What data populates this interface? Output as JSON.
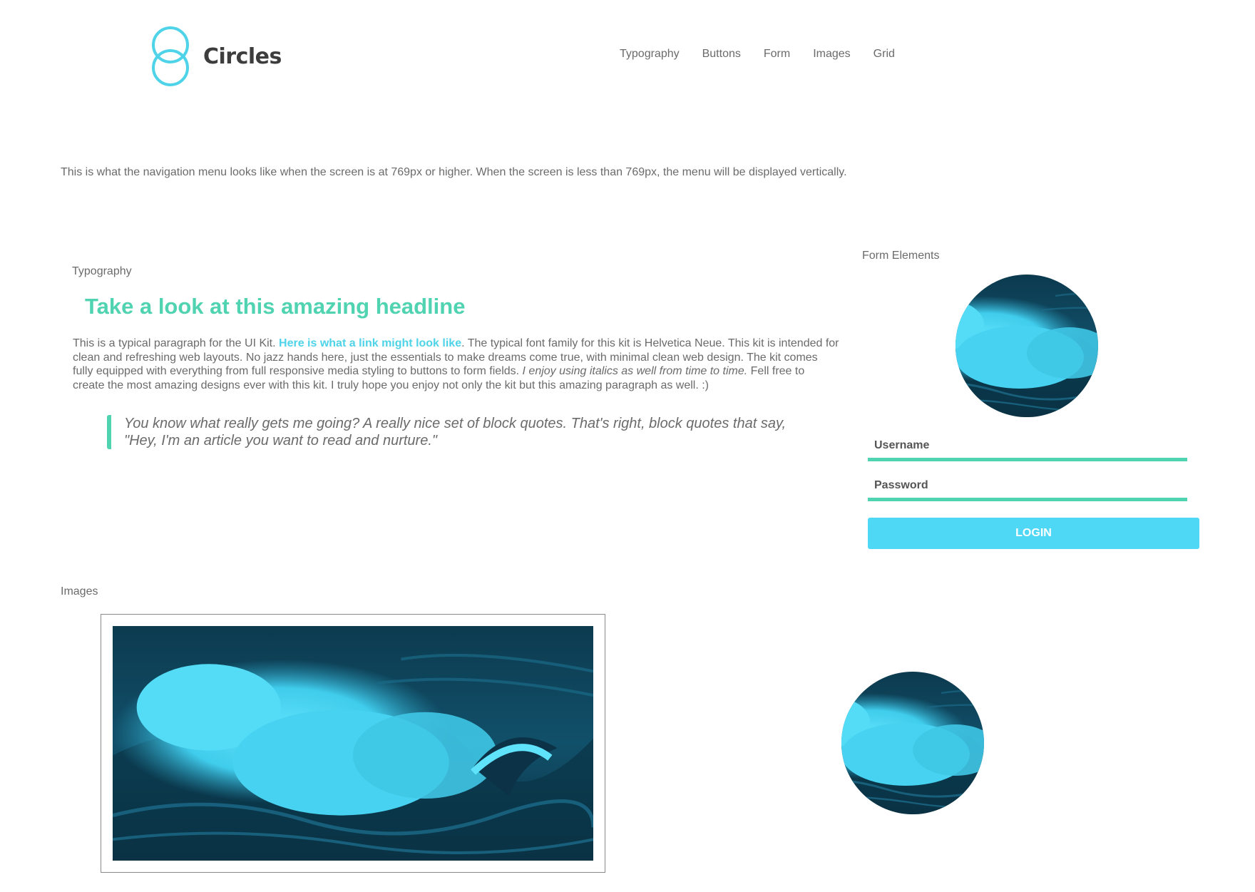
{
  "brand": {
    "name": "Circles",
    "accent": "#4fd3b0",
    "link_color": "#4fd3e8",
    "button_color": "#4fd8f5",
    "logo_icon": "circles-logo-icon"
  },
  "nav": {
    "items": [
      {
        "label": "Typography"
      },
      {
        "label": "Buttons"
      },
      {
        "label": "Form"
      },
      {
        "label": "Images"
      },
      {
        "label": "Grid"
      }
    ]
  },
  "intro_text": "This is what the navigation menu looks like when the screen is at 769px or higher. When the screen is less than 769px, the menu will be displayed vertically.",
  "typography": {
    "label": "Typography",
    "headline": "Take a look at this amazing headline",
    "paragraph": {
      "lead": "This is a typical paragraph for the UI Kit. ",
      "link": "Here is what a link might look like",
      "after_link": ". The typical font family for this kit is Helvetica Neue. This kit is intended for clean and refreshing web layouts. No jazz hands here, just the essentials to make dreams come true, with minimal clean web design. The kit comes fully equipped with everything from full responsive media styling to buttons to form fields. ",
      "italic": "I enjoy using italics as well from time to time.",
      "tail": " Fell free to create the most amazing designs ever with this kit. I truly hope you enjoy not only the kit but this amazing paragraph as well. :)"
    },
    "blockquote": "You know what really gets me going? A really nice set of block quotes. That's right, block quotes that say, \"Hey, I'm an article you want to read and nurture.\""
  },
  "form": {
    "label": "Form Elements",
    "username_placeholder": "Username",
    "password_placeholder": "Password",
    "login_label": "LOGIN"
  },
  "images": {
    "label": "Images"
  }
}
